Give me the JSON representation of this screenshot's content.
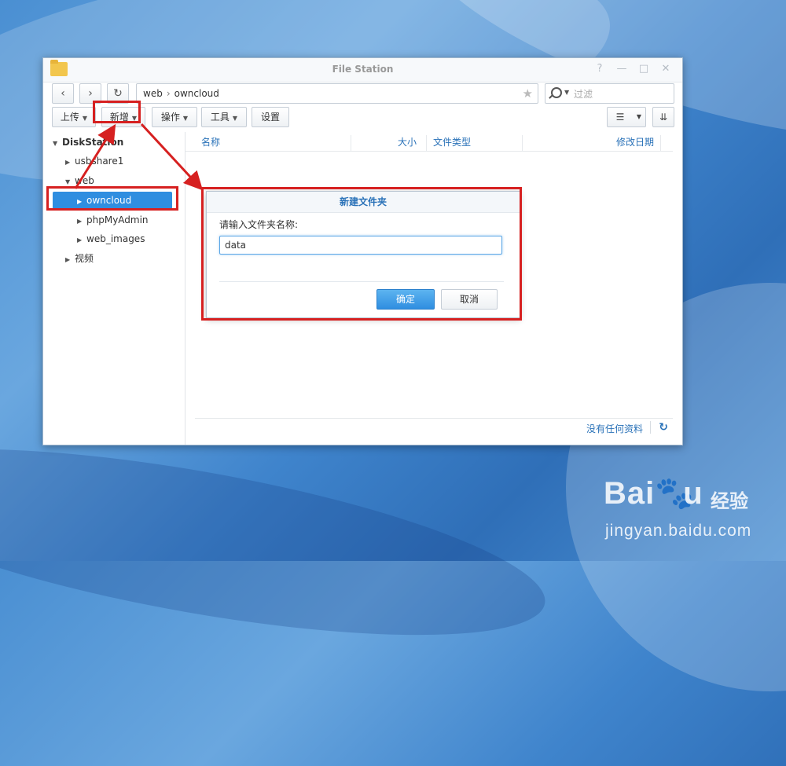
{
  "window": {
    "title": "File Station",
    "controls": [
      "?",
      "—",
      "□",
      "✕"
    ]
  },
  "nav": {
    "back_icon": "chevron-left-icon",
    "forward_icon": "chevron-right-icon",
    "refresh_icon": "refresh-icon",
    "path": [
      "web",
      "owncloud"
    ],
    "search_placeholder": "过滤"
  },
  "toolbar": {
    "upload": "上传",
    "create": "新增",
    "action": "操作",
    "tools": "工具",
    "settings": "设置"
  },
  "sidebar": {
    "root": "DiskStation",
    "items": [
      {
        "label": "usbshare1"
      },
      {
        "label": "web"
      },
      {
        "label": "owncloud"
      },
      {
        "label": "phpMyAdmin"
      },
      {
        "label": "web_images"
      },
      {
        "label": "视频"
      }
    ]
  },
  "filelist": {
    "columns": [
      "名称",
      "大小",
      "文件类型",
      "修改日期"
    ],
    "empty_text": "没有任何资料"
  },
  "dialog": {
    "title": "新建文件夹",
    "label": "请输入文件夹名称:",
    "value": "data",
    "ok": "确定",
    "cancel": "取消"
  },
  "watermark": {
    "logo": "Baidu",
    "cn": "经验",
    "url": "jingyan.baidu.com"
  },
  "colors": {
    "accent": "#2f8ee0",
    "annotation": "#d62020"
  }
}
